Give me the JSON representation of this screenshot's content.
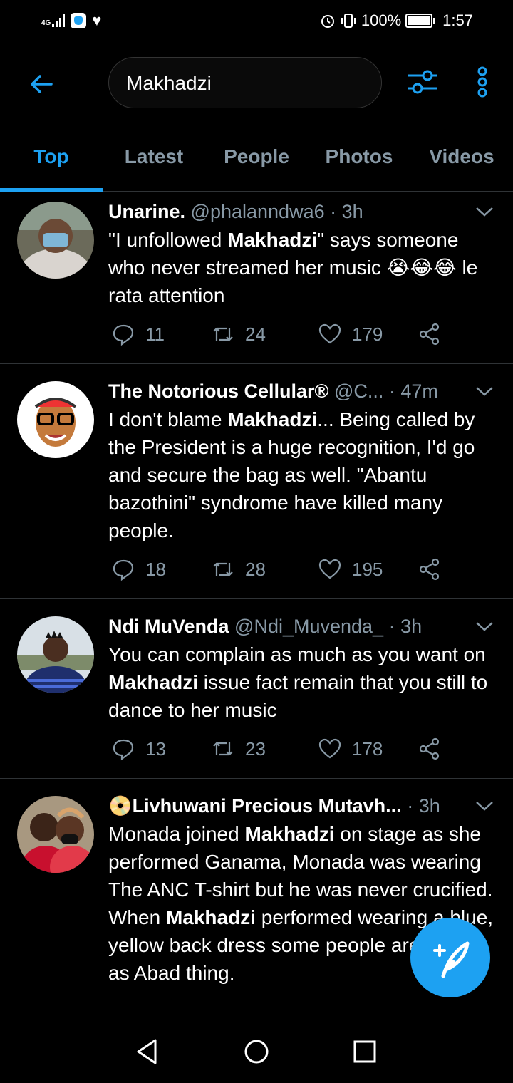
{
  "status": {
    "network": "4G",
    "battery_pct": "100%",
    "time": "1:57"
  },
  "search": {
    "query": "Makhadzi"
  },
  "tabs": [
    "Top",
    "Latest",
    "People",
    "Photos",
    "Videos"
  ],
  "tweets": [
    {
      "name": "Unarine⁡.",
      "handle": "@phalanndwa6",
      "time": "· 3h",
      "text_html": "\"I unfollowed <b>Makhadzi</b>\" says someone who never streamed her music 😭😂😂 le rata attention",
      "replies": "11",
      "retweets": "24",
      "likes": "179"
    },
    {
      "name": "The Notorious Cellular®",
      "handle": "@C...",
      "time": "· 47m",
      "text_html": "I don't blame <b>Makhadzi</b>... Being called by the President is a huge recognition, I'd go and secure the bag as well. \"Abantu bazothini\" syndrome have killed many people.",
      "replies": "18",
      "retweets": "28",
      "likes": "195"
    },
    {
      "name": "Ndi MuVenda",
      "handle": "@Ndi_Muvenda_",
      "time": "· 3h",
      "text_html": "You can complain as much as you want on <b>Makhadzi</b> issue fact remain that you still to dance to her music",
      "replies": "13",
      "retweets": "23",
      "likes": "178"
    },
    {
      "name": "📀Livhuwani Precious Mutavh...",
      "handle": "",
      "time": "· 3h",
      "text_html": "Monada joined <b>Makhadzi</b> on stage as she performed Ganama, Monada was wearing The ANC T-shirt but he was never crucified. When <b>Makhadzi</b> performed wearing a blue, yellow back dress some people are now at as Abad thing.",
      "replies": "",
      "retweets": "",
      "likes": ""
    }
  ],
  "colors": {
    "accent": "#1da1f2",
    "muted": "#8899a6",
    "divider": "#2f3336"
  }
}
